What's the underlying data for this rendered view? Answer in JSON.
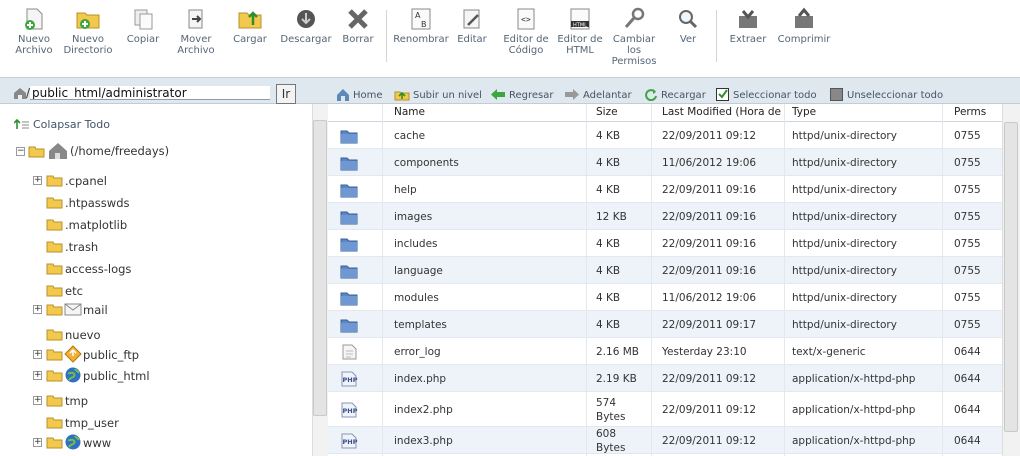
{
  "toolbar": {
    "items": [
      {
        "label": "Nuevo\nArchivo",
        "icon": "new-file-icon"
      },
      {
        "label": "Nuevo\nDirectorio",
        "icon": "new-folder-icon"
      },
      {
        "label": "Copiar",
        "icon": "copy-icon"
      },
      {
        "label": "Mover\nArchivo",
        "icon": "move-icon"
      },
      {
        "label": "Cargar",
        "icon": "upload-icon"
      },
      {
        "label": "Descargar",
        "icon": "download-icon"
      },
      {
        "label": "Borrar",
        "icon": "delete-icon"
      },
      {
        "label": "Renombrar",
        "icon": "rename-icon"
      },
      {
        "label": "Editar",
        "icon": "edit-icon"
      },
      {
        "label": "Editor de\nCódigo",
        "icon": "code-editor-icon"
      },
      {
        "label": "Editor de\nHTML",
        "icon": "html-editor-icon"
      },
      {
        "label": "Cambiar\nlos\nPermisos",
        "icon": "permissions-icon"
      },
      {
        "label": "Ver",
        "icon": "view-icon"
      },
      {
        "label": "Extraer",
        "icon": "extract-icon"
      },
      {
        "label": "Comprimir",
        "icon": "compress-icon"
      }
    ]
  },
  "path": {
    "value": "public_html/administrator",
    "go_label": "Ir"
  },
  "nav": {
    "home": "Home",
    "up": "Subir un nivel",
    "back": "Regresar",
    "forward": "Adelantar",
    "reload": "Recargar",
    "select_all": "Seleccionar todo",
    "deselect_all": "Unseleccionar todo"
  },
  "tree": {
    "collapse": "Colapsar Todo",
    "root": "(/home/freedays)",
    "items": [
      {
        "label": ".cpanel",
        "expandable": true
      },
      {
        "label": ".htpasswds",
        "expandable": false
      },
      {
        "label": ".matplotlib",
        "expandable": false
      },
      {
        "label": ".trash",
        "expandable": false
      },
      {
        "label": "access-logs",
        "expandable": false
      },
      {
        "label": "etc",
        "expandable": false
      },
      {
        "label": "mail",
        "expandable": true
      },
      {
        "label": "nuevo",
        "expandable": false
      },
      {
        "label": "public_ftp",
        "expandable": true
      },
      {
        "label": "public_html",
        "expandable": true
      },
      {
        "label": "tmp",
        "expandable": true
      },
      {
        "label": "tmp_user",
        "expandable": false
      },
      {
        "label": "www",
        "expandable": true
      }
    ]
  },
  "table": {
    "headers": {
      "name": "Name",
      "size": "Size",
      "modified": "Last Modified (Hora de verano)",
      "type": "Type",
      "perms": "Perms"
    },
    "rows": [
      {
        "icon": "folder",
        "name": "cache",
        "size": "4 KB",
        "modified": "22/09/2011 09:12",
        "type": "httpd/unix-directory",
        "perms": "0755"
      },
      {
        "icon": "folder",
        "name": "components",
        "size": "4 KB",
        "modified": "11/06/2012 19:06",
        "type": "httpd/unix-directory",
        "perms": "0755"
      },
      {
        "icon": "folder",
        "name": "help",
        "size": "4 KB",
        "modified": "22/09/2011 09:16",
        "type": "httpd/unix-directory",
        "perms": "0755"
      },
      {
        "icon": "folder",
        "name": "images",
        "size": "12 KB",
        "modified": "22/09/2011 09:16",
        "type": "httpd/unix-directory",
        "perms": "0755"
      },
      {
        "icon": "folder",
        "name": "includes",
        "size": "4 KB",
        "modified": "22/09/2011 09:16",
        "type": "httpd/unix-directory",
        "perms": "0755"
      },
      {
        "icon": "folder",
        "name": "language",
        "size": "4 KB",
        "modified": "22/09/2011 09:16",
        "type": "httpd/unix-directory",
        "perms": "0755"
      },
      {
        "icon": "folder",
        "name": "modules",
        "size": "4 KB",
        "modified": "11/06/2012 19:06",
        "type": "httpd/unix-directory",
        "perms": "0755"
      },
      {
        "icon": "folder",
        "name": "templates",
        "size": "4 KB",
        "modified": "22/09/2011 09:17",
        "type": "httpd/unix-directory",
        "perms": "0755"
      },
      {
        "icon": "file",
        "name": "error_log",
        "size": "2.16 MB",
        "modified": "Yesterday 23:10",
        "type": "text/x-generic",
        "perms": "0644"
      },
      {
        "icon": "php",
        "name": "index.php",
        "size": "2.19 KB",
        "modified": "22/09/2011 09:12",
        "type": "application/x-httpd-php",
        "perms": "0644"
      },
      {
        "icon": "php",
        "name": "index2.php",
        "size": "574\nBytes",
        "modified": "22/09/2011 09:12",
        "type": "application/x-httpd-php",
        "perms": "0644"
      },
      {
        "icon": "php",
        "name": "index3.php",
        "size": "608\nBytes",
        "modified": "22/09/2011 09:12",
        "type": "application/x-httpd-php",
        "perms": "0644"
      }
    ]
  },
  "colors": {
    "accent": "#dfe7ef",
    "row_alt": "#eef3f9",
    "folder_blue": "#5b86c4",
    "folder_yellow": "#f2c94c"
  }
}
